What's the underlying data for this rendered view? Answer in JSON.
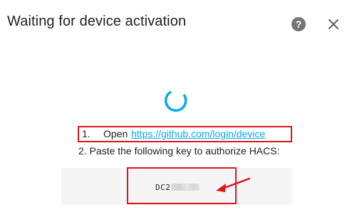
{
  "dialog": {
    "title": "Waiting for device activation",
    "help_icon": "question-circle-icon",
    "help_glyph": "?",
    "close_icon": "close-icon"
  },
  "steps": {
    "step1_number": "1.",
    "step1_text": "Open",
    "step1_link": "https://github.com/login/device",
    "step2_text": "2. Paste the following key to authorize HACS:"
  },
  "device_code": {
    "visible_prefix": "DC2"
  },
  "colors": {
    "link": "#03a9f4",
    "spinner": "#03a9f4",
    "annotation": "#e0141f",
    "code_bg": "#f5f5f5"
  }
}
